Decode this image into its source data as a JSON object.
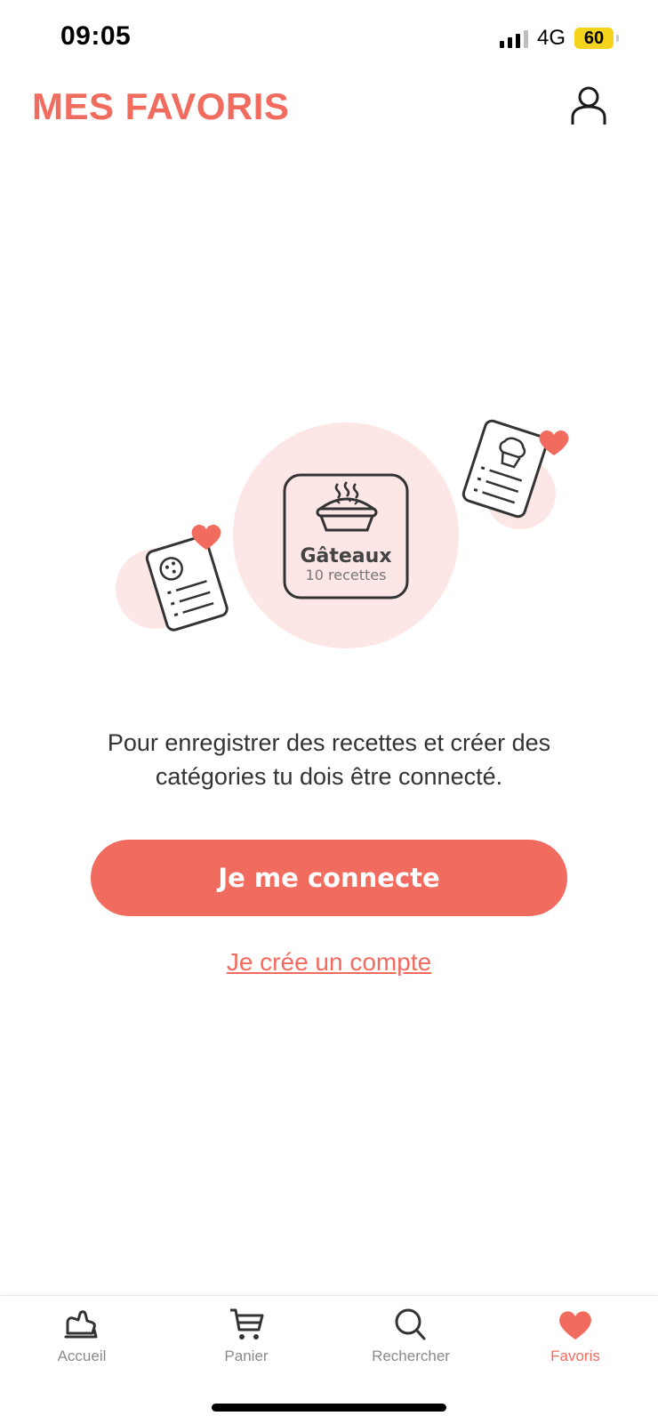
{
  "status_bar": {
    "time": "09:05",
    "network": "4G",
    "battery": "60"
  },
  "header": {
    "title": "MES FAVORIS"
  },
  "illustration": {
    "card_title": "Gâteaux",
    "card_subtitle": "10 recettes"
  },
  "main": {
    "message": "Pour enregistrer des recettes et créer des catégories tu dois être connecté.",
    "connect_label": "Je me connecte",
    "create_account_label": "Je crée un compte"
  },
  "tabbar": {
    "items": [
      {
        "label": "Accueil",
        "icon": "oven-mitt-icon",
        "active": false
      },
      {
        "label": "Panier",
        "icon": "cart-icon",
        "active": false
      },
      {
        "label": "Rechercher",
        "icon": "search-icon",
        "active": false
      },
      {
        "label": "Favoris",
        "icon": "heart-icon",
        "active": true
      }
    ]
  },
  "colors": {
    "accent": "#f26b5f",
    "accent_light": "#fde6e6",
    "text": "#333333",
    "inactive": "#8a8a8a",
    "battery": "#f3d31b"
  }
}
